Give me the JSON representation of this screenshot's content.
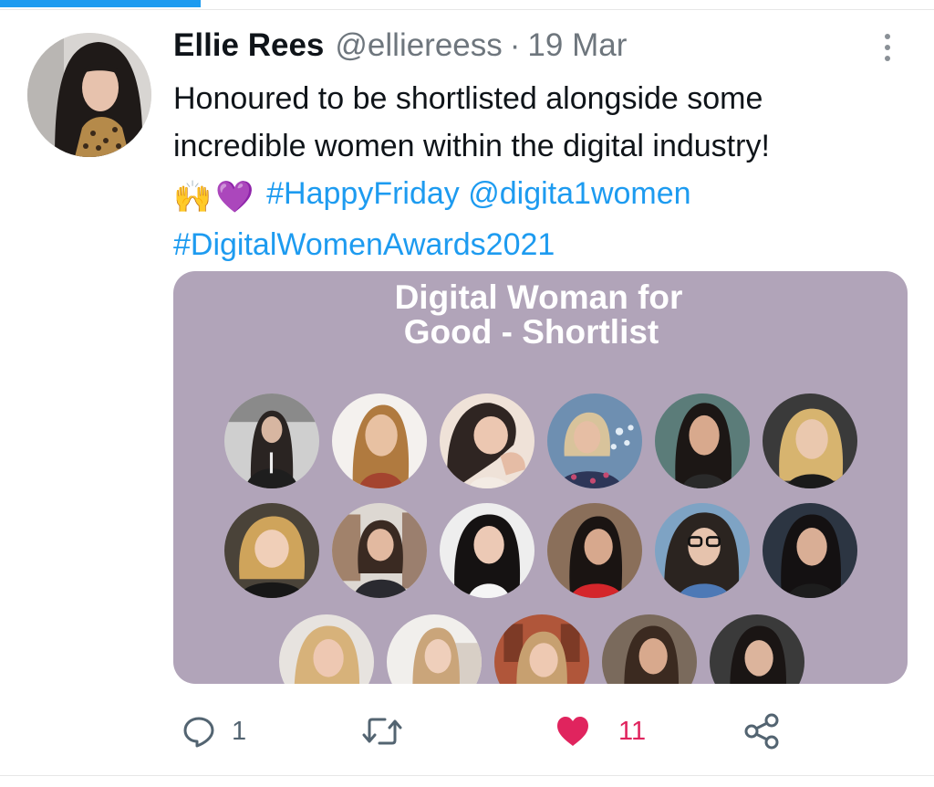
{
  "tweet": {
    "author_name": "Ellie Rees",
    "handle": "@elliereess",
    "separator": "·",
    "time": "19 Mar",
    "text_line_1": "Honoured to be shortlisted alongside some",
    "text_line_2": "incredible women within the digital industry!",
    "emoji_1": "🙌",
    "emoji_2": "💜",
    "hashtag_1": "#HappyFriday",
    "mention": "@digita1women",
    "hashtag_2": "#DigitalWomenAwards2021"
  },
  "media": {
    "title_line_1": "Digital Woman for",
    "title_line_2": "Good - Shortlist",
    "background_color": "#b1a4b9"
  },
  "actions": {
    "reply_count": "1",
    "retweet_count": "",
    "like_count": "11",
    "like_color": "#e0245e",
    "link_color": "#1d9bf0"
  },
  "icons": [
    "more-vertical-icon",
    "reply-icon",
    "retweet-icon",
    "like-heart-icon",
    "share-icon"
  ]
}
